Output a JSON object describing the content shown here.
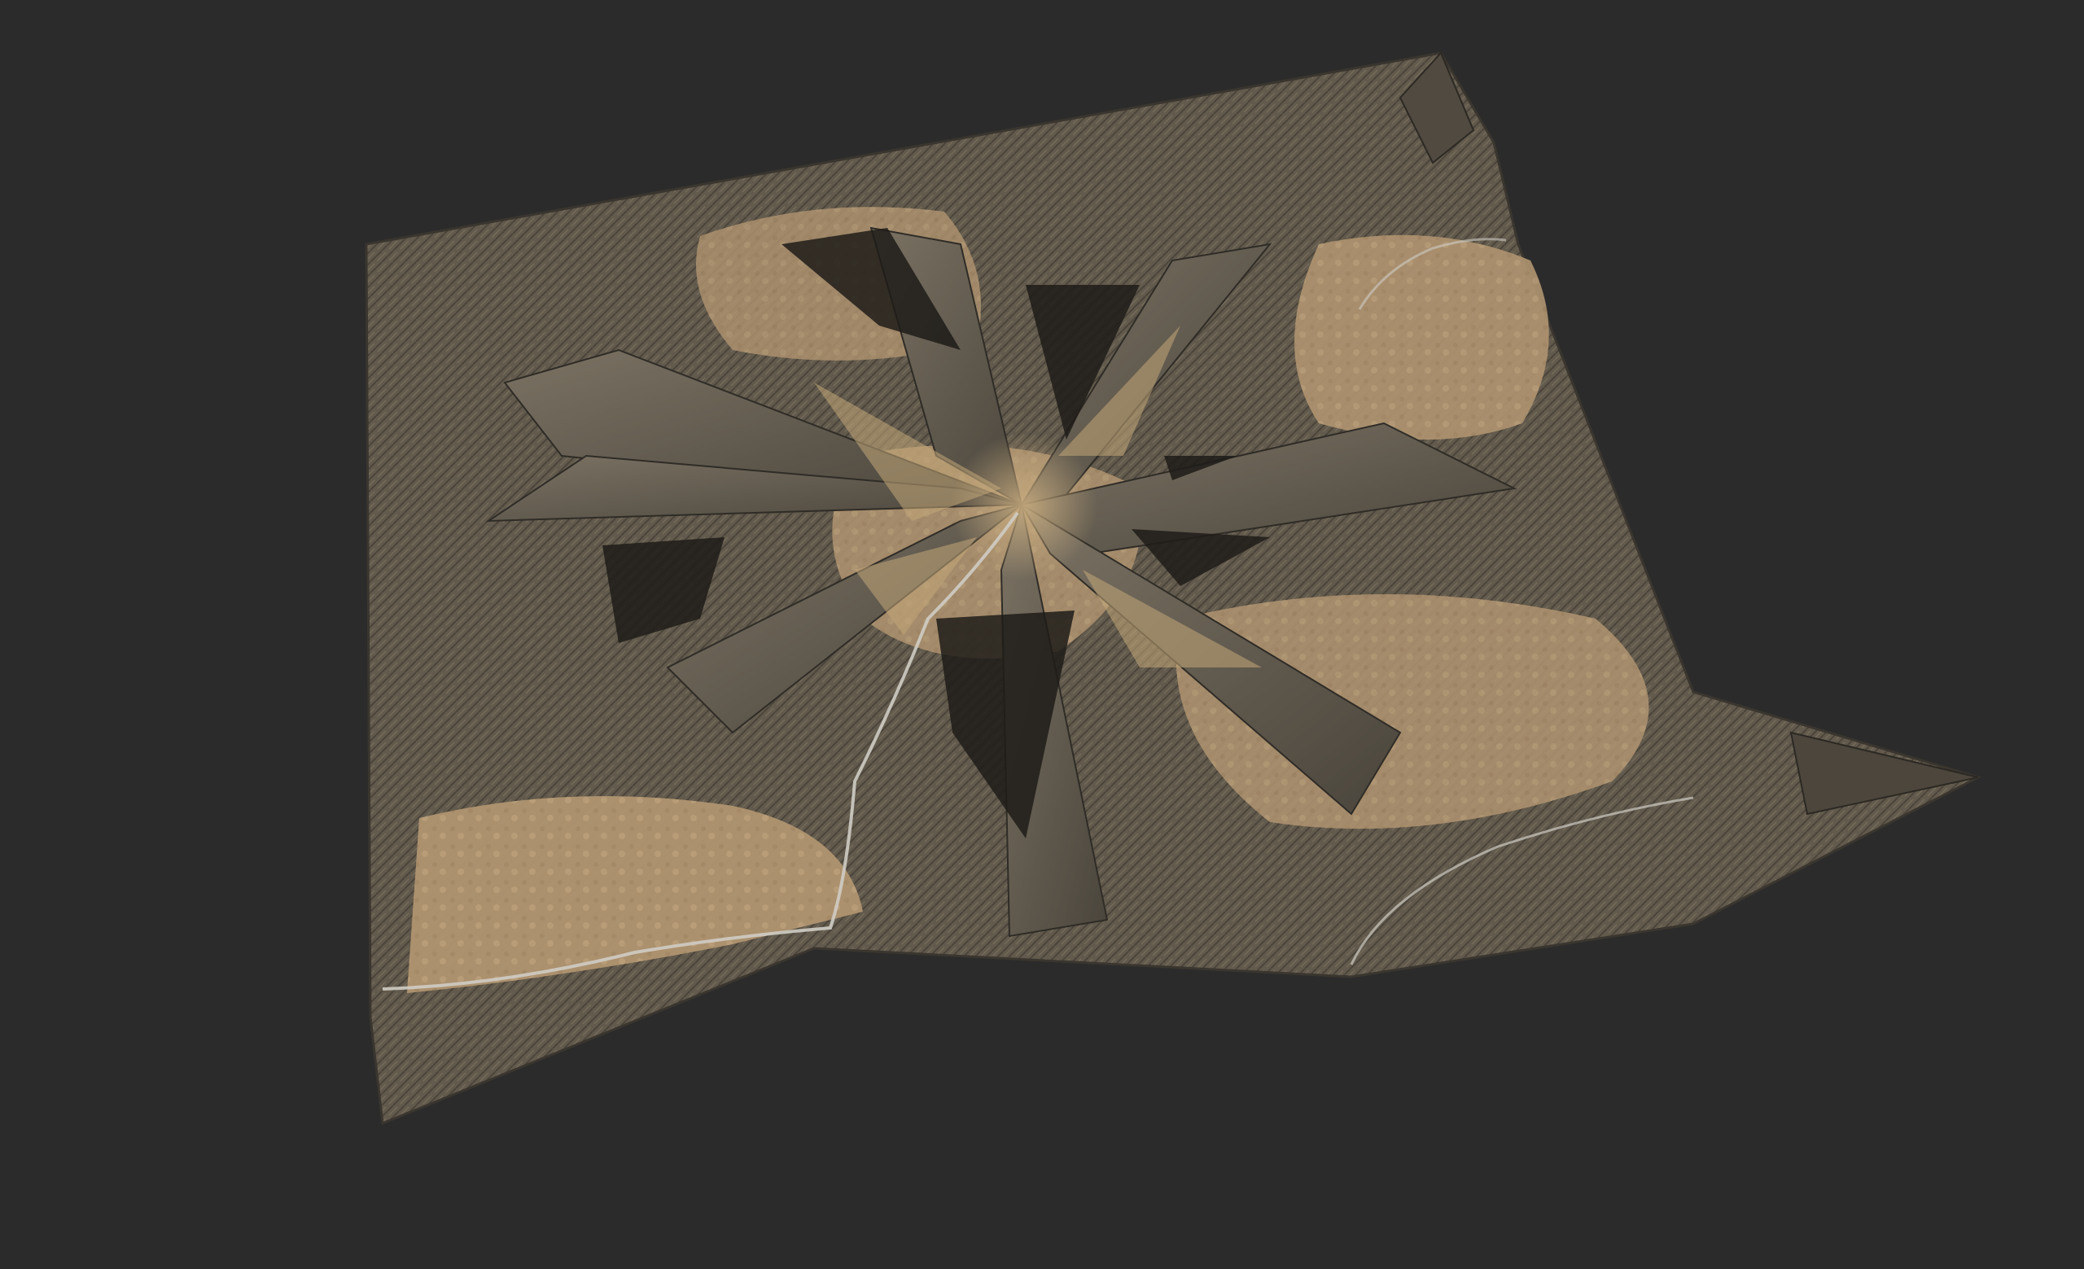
{
  "scene": {
    "subject": "terrain-heightmap-render",
    "colors": {
      "background": "#2b2b2b",
      "sand": "#b99c6f",
      "sand_light": "#cdb188",
      "rock": "#6b6253",
      "rock_dark": "#3e3a33",
      "shadow": "#1f1d1a",
      "river": "#c9c7bf"
    }
  }
}
